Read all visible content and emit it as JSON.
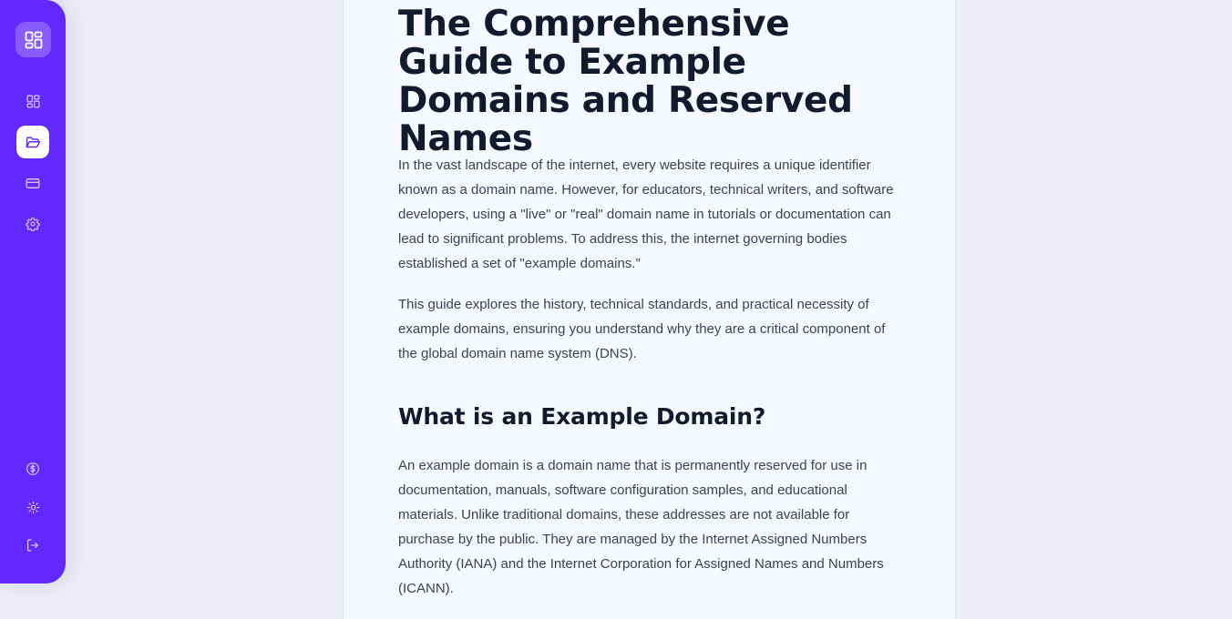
{
  "sidebar": {
    "logo_icon": "dashboard-grid-icon",
    "nav_top": [
      {
        "name": "dashboard",
        "icon": "dashboard-grid-icon",
        "active": false
      },
      {
        "name": "files",
        "icon": "folder-open-icon",
        "active": true
      },
      {
        "name": "billing",
        "icon": "credit-card-icon",
        "active": false
      },
      {
        "name": "settings",
        "icon": "gear-icon",
        "active": false
      }
    ],
    "nav_bottom": [
      {
        "name": "pricing",
        "icon": "dollar-circle-icon"
      },
      {
        "name": "theme",
        "icon": "sun-icon"
      },
      {
        "name": "logout",
        "icon": "logout-icon"
      }
    ],
    "colors": {
      "background": "#6328fc",
      "active_bg": "#ffffff",
      "icon": "#d9ccff",
      "active_icon": "#6328fc"
    }
  },
  "article": {
    "title": "The Comprehensive Guide to Example Domains and Reserved Names",
    "paragraphs": [
      "In the vast landscape of the internet, every website requires a unique identifier known as a domain name. However, for educators, technical writers, and software developers, using a \"live\" or \"real\" domain name in tutorials or documentation can lead to significant problems. To address this, the internet governing bodies established a set of \"example domains.\"",
      "This guide explores the history, technical standards, and practical necessity of example domains, ensuring you understand why they are a critical component of the global domain name system (DNS)."
    ],
    "section_heading": "What is an Example Domain?",
    "section_paragraph": "An example domain is a domain name that is permanently reserved for use in documentation, manuals, software configuration samples, and educational materials. Unlike traditional domains, these addresses are not available for purchase by the public. They are managed by the Internet Assigned Numbers Authority (IANA) and the Internet Corporation for Assigned Names and Numbers (ICANN)."
  }
}
